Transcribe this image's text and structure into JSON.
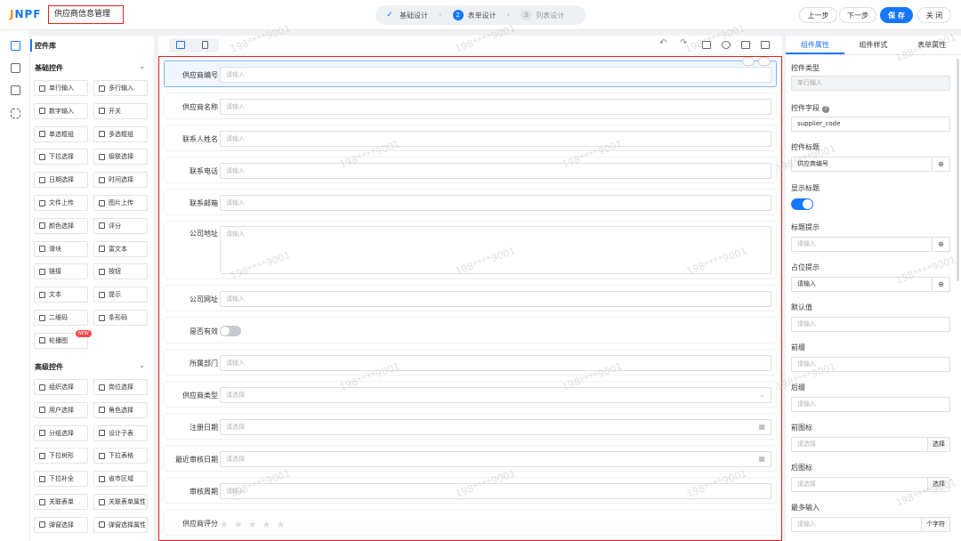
{
  "app": {
    "logo_letters": [
      "J",
      "NPF"
    ],
    "page_title": "供应商信息管理"
  },
  "steps": [
    {
      "index": "✓",
      "label": "基础设计",
      "state": "done"
    },
    {
      "index": "2",
      "label": "表单设计",
      "state": "active"
    },
    {
      "index": "3",
      "label": "列表设计",
      "state": "todo"
    }
  ],
  "actions": {
    "prev": "上一步",
    "next": "下一步",
    "save": "保 存",
    "close": "关 闭"
  },
  "library": {
    "title": "控件库",
    "basic_title": "基础控件",
    "basic": [
      "单行输入",
      "多行输入",
      "数字输入",
      "开关",
      "单选框组",
      "多选框组",
      "下拉选择",
      "级联选择",
      "日期选择",
      "时间选择",
      "文件上传",
      "图片上传",
      "颜色选择",
      "评分",
      "滑块",
      "富文本",
      "链接",
      "按钮",
      "文本",
      "提示",
      "二维码",
      "条形码",
      "轮播图"
    ],
    "new_badge": "NEW",
    "advanced_title": "高级控件",
    "advanced": [
      "组织选择",
      "岗位选择",
      "用户选择",
      "角色选择",
      "分组选择",
      "设计子表",
      "下拉树形",
      "下拉表格",
      "下拉补全",
      "省市区域",
      "关联表单",
      "关联表单属性",
      "弹窗选择",
      "弹窗选择属性"
    ]
  },
  "form": {
    "fields": [
      {
        "label": "供应商编号",
        "placeholder": "请输入",
        "kind": "input"
      },
      {
        "label": "供应商名称",
        "placeholder": "请输入",
        "kind": "input"
      },
      {
        "label": "联系人姓名",
        "placeholder": "请输入",
        "kind": "input"
      },
      {
        "label": "联系电话",
        "placeholder": "请输入",
        "kind": "input"
      },
      {
        "label": "联系邮箱",
        "placeholder": "请输入",
        "kind": "input"
      },
      {
        "label": "公司地址",
        "placeholder": "请输入",
        "kind": "textarea"
      },
      {
        "label": "公司网址",
        "placeholder": "请输入",
        "kind": "input"
      },
      {
        "label": "是否有效",
        "placeholder": "",
        "kind": "switch"
      },
      {
        "label": "所属部门",
        "placeholder": "请输入",
        "kind": "input"
      },
      {
        "label": "供应商类型",
        "placeholder": "请选择",
        "kind": "select"
      },
      {
        "label": "注册日期",
        "placeholder": "请选择",
        "kind": "date"
      },
      {
        "label": "最近审核日期",
        "placeholder": "请选择",
        "kind": "date"
      },
      {
        "label": "审核周期",
        "placeholder": "请输入",
        "kind": "input"
      },
      {
        "label": "供应商评分",
        "placeholder": "",
        "kind": "rate"
      }
    ]
  },
  "props": {
    "tabs": [
      "组件属性",
      "组件样式",
      "表单属性"
    ],
    "control_type_label": "控件类型",
    "control_type_value": "单行输入",
    "field_label": "控件字段",
    "field_value": "supplier_code",
    "title_label": "控件标题",
    "title_value": "供应商编号",
    "show_title_label": "显示标题",
    "title_tip_label": "标题提示",
    "title_tip_ph": "请输入",
    "placeholder_label": "占位提示",
    "placeholder_value": "请输入",
    "default_label": "默认值",
    "default_ph": "请输入",
    "prefix_label": "前缀",
    "prefix_ph": "请输入",
    "suffix_label": "后缀",
    "suffix_ph": "请输入",
    "prefix_icon_label": "前图标",
    "prefix_icon_ph": "请选择",
    "select_btn": "选择",
    "suffix_icon_label": "后图标",
    "suffix_icon_ph": "请选择",
    "maxlen_label": "最多输入",
    "maxlen_ph": "请输入",
    "maxlen_unit": "个字符"
  },
  "watermark": "198****9001",
  "colors": {
    "primary": "#1677ff",
    "highlight_border": "#e02020"
  }
}
